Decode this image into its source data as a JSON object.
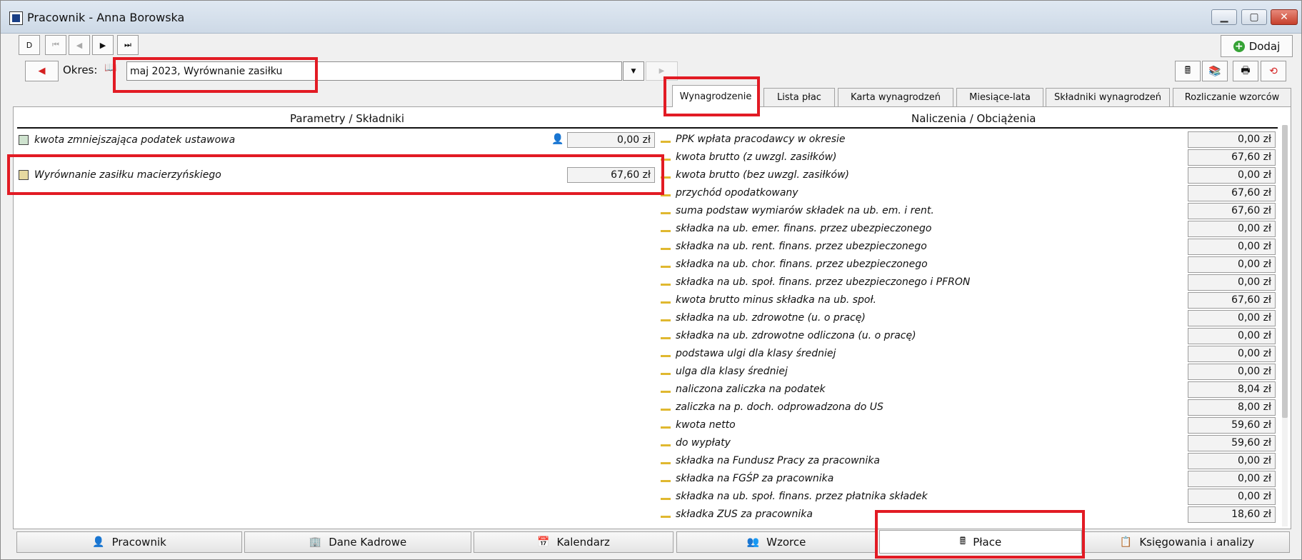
{
  "window": {
    "title": "Pracownik - Anna Borowska",
    "minimize": "▁",
    "maximize": "▢",
    "close": "✕"
  },
  "nav": {
    "new": "D",
    "first": "⏮",
    "prev": "◀",
    "next": "▶",
    "last": "⏭"
  },
  "okres": {
    "label": "Okres:",
    "value": "maj 2023, Wyrównanie zasiłku",
    "prev_arrow": "◀",
    "next_arrow": "▶",
    "dropdown_arrow": "▼"
  },
  "toolbar": {
    "add_label": "Dodaj",
    "add_icon": "+"
  },
  "tabs": [
    "Wynagrodzenie",
    "Lista płac",
    "Karta wynagrodzeń",
    "Miesiące-lata",
    "Składniki wynagrodzeń",
    "Rozliczanie wzorców"
  ],
  "columns": {
    "left": "Parametry / Składniki",
    "right": "Naliczenia / Obciążenia"
  },
  "left_rows": [
    {
      "label": "kwota zmniejszająca podatek ustawowa",
      "value": "0,00 zł"
    },
    {
      "label": "Wyrównanie zasiłku macierzyńskiego",
      "value": "67,60 zł"
    }
  ],
  "right_rows": [
    {
      "label": "PPK wpłata pracodawcy w okresie",
      "value": "0,00 zł"
    },
    {
      "label": "kwota brutto (z uwzgl. zasiłków)",
      "value": "67,60 zł"
    },
    {
      "label": "kwota brutto (bez uwzgl. zasiłków)",
      "value": "0,00 zł"
    },
    {
      "label": "przychód opodatkowany",
      "value": "67,60 zł"
    },
    {
      "label": "suma podstaw wymiarów składek na ub. em. i rent.",
      "value": "67,60 zł"
    },
    {
      "label": "składka na ub. emer. finans. przez ubezpieczonego",
      "value": "0,00 zł"
    },
    {
      "label": "składka na ub. rent. finans. przez ubezpieczonego",
      "value": "0,00 zł"
    },
    {
      "label": "składka na ub. chor. finans. przez ubezpieczonego",
      "value": "0,00 zł"
    },
    {
      "label": "składka na ub. społ. finans. przez ubezpieczonego i PFRON",
      "value": "0,00 zł"
    },
    {
      "label": "kwota brutto minus składka na ub. społ.",
      "value": "67,60 zł"
    },
    {
      "label": "składka na ub. zdrowotne (u. o pracę)",
      "value": "0,00 zł"
    },
    {
      "label": "składka na ub. zdrowotne odliczona (u. o pracę)",
      "value": "0,00 zł"
    },
    {
      "label": "podstawa ulgi dla klasy średniej",
      "value": "0,00 zł"
    },
    {
      "label": "ulga dla klasy średniej",
      "value": "0,00 zł"
    },
    {
      "label": "naliczona zaliczka na podatek",
      "value": "8,04 zł"
    },
    {
      "label": "zaliczka na p. doch. odprowadzona do US",
      "value": "8,00 zł"
    },
    {
      "label": "kwota netto",
      "value": "59,60 zł"
    },
    {
      "label": "do wypłaty",
      "value": "59,60 zł"
    },
    {
      "label": "składka na Fundusz Pracy za pracownika",
      "value": "0,00 zł"
    },
    {
      "label": "składka na FGŚP za pracownika",
      "value": "0,00 zł"
    },
    {
      "label": "składka na ub. społ. finans. przez płatnika składek",
      "value": "0,00 zł"
    },
    {
      "label": "składka ZUS za pracownika",
      "value": "18,60 zł"
    }
  ],
  "bottom_tabs": [
    "Pracownik",
    "Dane Kadrowe",
    "Kalendarz",
    "Wzorce",
    "Płace",
    "Księgowania i analizy"
  ],
  "icons": {
    "person": "👤",
    "building": "🏢",
    "calendar": "📅",
    "people": "👥",
    "calculator": "🖩",
    "ledger": "📋",
    "book": "📖",
    "print": "🖶",
    "refresh": "⟲",
    "stack": "📚"
  },
  "colors": {
    "highlight": "#e21b24",
    "add_green": "#36a336",
    "prev_red": "#d42020"
  }
}
